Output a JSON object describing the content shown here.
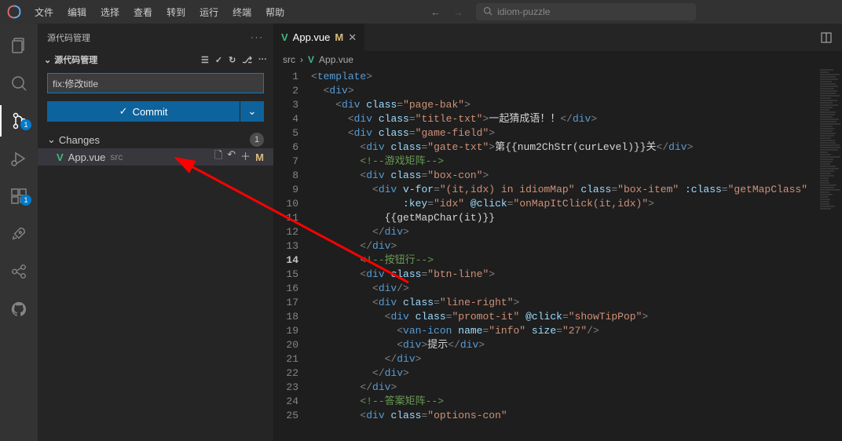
{
  "title_menu": [
    "文件",
    "编辑",
    "选择",
    "查看",
    "转到",
    "运行",
    "终端",
    "帮助"
  ],
  "search_placeholder": "idiom-puzzle",
  "scm": {
    "title": "源代码管理",
    "section": "源代码管理",
    "commit_msg": "fix:修改title",
    "commit_btn": "Commit",
    "changes_label": "Changes",
    "changes_count": "1",
    "file": {
      "name": "App.vue",
      "path": "src",
      "status": "M"
    }
  },
  "activity_badges": {
    "scm": "1",
    "ext": "1"
  },
  "editor": {
    "tab": {
      "name": "App.vue",
      "status": "M"
    },
    "breadcrumb": {
      "folder": "src",
      "file": "App.vue"
    },
    "lines": [
      {
        "n": 1,
        "i": 0,
        "t": "tag",
        "el": "template"
      },
      {
        "n": 2,
        "i": 1,
        "t": "tag",
        "el": "div"
      },
      {
        "n": 3,
        "i": 2,
        "t": "tago",
        "el": "div",
        "attrs": [
          {
            "n": "class",
            "v": "page-bak"
          }
        ]
      },
      {
        "n": 4,
        "i": 3,
        "t": "tagtxt",
        "el": "div",
        "attrs": [
          {
            "n": "class",
            "v": "title-txt"
          }
        ],
        "txt": "一起猜成语！！"
      },
      {
        "n": 5,
        "i": 3,
        "t": "tago",
        "el": "div",
        "attrs": [
          {
            "n": "class",
            "v": "game-field"
          }
        ]
      },
      {
        "n": 6,
        "i": 4,
        "t": "tagtxt",
        "el": "div",
        "attrs": [
          {
            "n": "class",
            "v": "gate-txt"
          }
        ],
        "txt": "第{{num2ChStr(curLevel)}}关"
      },
      {
        "n": 7,
        "i": 4,
        "t": "cm",
        "txt": "<!--游戏矩阵-->"
      },
      {
        "n": 8,
        "i": 4,
        "t": "tago",
        "el": "div",
        "attrs": [
          {
            "n": "class",
            "v": "box-con"
          }
        ]
      },
      {
        "n": 9,
        "i": 5,
        "t": "tagomulti",
        "el": "div",
        "attrs": [
          {
            "n": "v-for",
            "v": "(it,idx) in idiomMap"
          },
          {
            "n": "class",
            "v": "box-item"
          },
          {
            "n": ":class",
            "v": "getMapClass"
          }
        ],
        "noclose": true
      },
      {
        "n": 10,
        "i": 7,
        "t": "attrs",
        "attrs": [
          {
            "n": ":key",
            "v": "idx"
          },
          {
            "n": "@click",
            "v": "onMapItClick(it,idx)"
          }
        ],
        "close": true
      },
      {
        "n": 11,
        "i": 6,
        "t": "txt",
        "txt": "{{getMapChar(it)}}"
      },
      {
        "n": 12,
        "i": 5,
        "t": "tagc",
        "el": "div"
      },
      {
        "n": 13,
        "i": 4,
        "t": "tagc",
        "el": "div"
      },
      {
        "n": 14,
        "i": 4,
        "t": "cm",
        "txt": "<!--按钮行-->",
        "cur": true
      },
      {
        "n": 15,
        "i": 4,
        "t": "tago",
        "el": "div",
        "attrs": [
          {
            "n": "class",
            "v": "btn-line"
          }
        ]
      },
      {
        "n": 16,
        "i": 5,
        "t": "tagself",
        "el": "div"
      },
      {
        "n": 17,
        "i": 5,
        "t": "tago",
        "el": "div",
        "attrs": [
          {
            "n": "class",
            "v": "line-right"
          }
        ]
      },
      {
        "n": 18,
        "i": 6,
        "t": "tago",
        "el": "div",
        "attrs": [
          {
            "n": "class",
            "v": "promot-it"
          },
          {
            "n": "@click",
            "v": "showTipPop"
          }
        ]
      },
      {
        "n": 19,
        "i": 7,
        "t": "tagselfattr",
        "el": "van-icon",
        "attrs": [
          {
            "n": "name",
            "v": "info"
          },
          {
            "n": "size",
            "v": "27"
          }
        ]
      },
      {
        "n": 20,
        "i": 7,
        "t": "tagtxt",
        "el": "div",
        "txt": "提示"
      },
      {
        "n": 21,
        "i": 6,
        "t": "tagc",
        "el": "div"
      },
      {
        "n": 22,
        "i": 5,
        "t": "tagc",
        "el": "div"
      },
      {
        "n": 23,
        "i": 4,
        "t": "tagc",
        "el": "div"
      },
      {
        "n": 24,
        "i": 4,
        "t": "cm",
        "txt": "<!--答案矩阵-->"
      },
      {
        "n": 25,
        "i": 4,
        "t": "tago",
        "el": "div",
        "attrs": [
          {
            "n": "class",
            "v": "options-con"
          }
        ],
        "partial": true
      }
    ]
  }
}
